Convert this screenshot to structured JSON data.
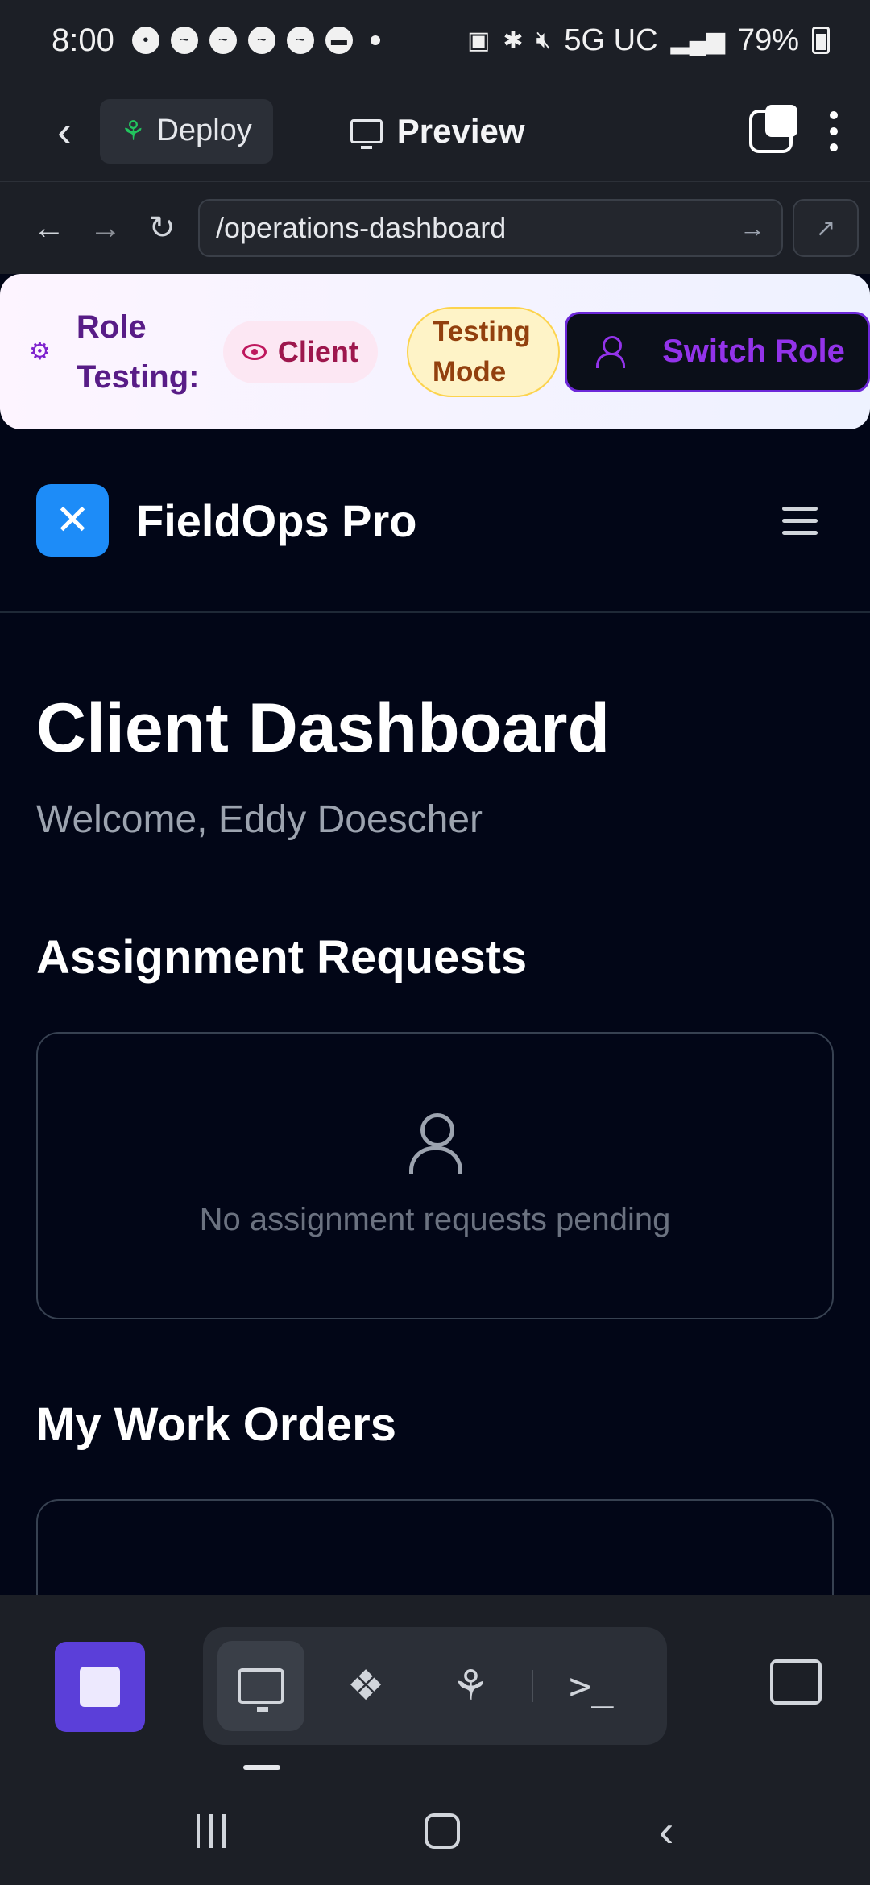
{
  "status_bar": {
    "time": "8:00",
    "network": "5G UC",
    "battery": "79%"
  },
  "browser": {
    "deploy_label": "Deploy",
    "preview_label": "Preview",
    "url": "/operations-dashboard"
  },
  "role_bar": {
    "label": "Role Testing:",
    "role": "Client",
    "mode": "Testing Mode",
    "switch_label": "Switch Role"
  },
  "site": {
    "brand": "FieldOps Pro"
  },
  "main": {
    "title": "Client Dashboard",
    "welcome": "Welcome, Eddy Doescher",
    "assignments_title": "Assignment Requests",
    "assignments_empty": "No assignment requests pending",
    "orders_title": "My Work Orders"
  },
  "colors": {
    "accent": "#5b3fd9",
    "logo": "#1d8cf8",
    "role_purple": "#9333ea"
  },
  "icons": {
    "toolbar": [
      "monitor-icon",
      "apps-icon",
      "deploy-icon",
      "terminal-icon"
    ]
  }
}
